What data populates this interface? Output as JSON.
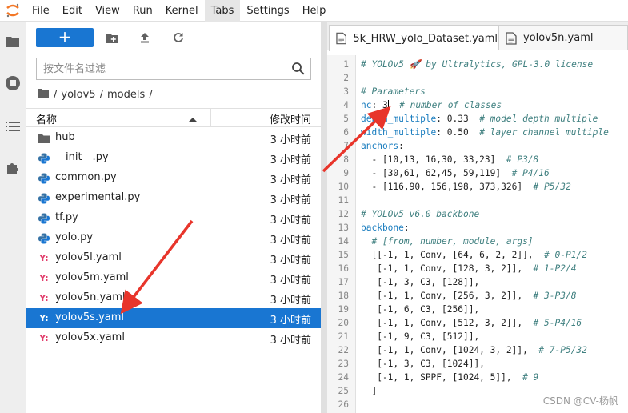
{
  "menubar": {
    "items": [
      "File",
      "Edit",
      "View",
      "Run",
      "Kernel",
      "Tabs",
      "Settings",
      "Help"
    ],
    "active": "Tabs"
  },
  "filebrowser": {
    "new_label": "+",
    "search": {
      "placeholder": "按文件名过滤"
    },
    "breadcrumb": [
      "/",
      "yolov5",
      "/",
      "models",
      "/"
    ],
    "header": {
      "name": "名称",
      "modified": "修改时间"
    },
    "rows": [
      {
        "name": "hub",
        "type": "folder",
        "modified": "3 小时前"
      },
      {
        "name": "__init__.py",
        "type": "python",
        "modified": "3 小时前"
      },
      {
        "name": "common.py",
        "type": "python",
        "modified": "3 小时前"
      },
      {
        "name": "experimental.py",
        "type": "python",
        "modified": "3 小时前"
      },
      {
        "name": "tf.py",
        "type": "python",
        "modified": "3 小时前"
      },
      {
        "name": "yolo.py",
        "type": "python",
        "modified": "3 小时前"
      },
      {
        "name": "yolov5l.yaml",
        "type": "yaml",
        "modified": "3 小时前"
      },
      {
        "name": "yolov5m.yaml",
        "type": "yaml",
        "modified": "3 小时前"
      },
      {
        "name": "yolov5n.yaml",
        "type": "yaml",
        "modified": "3 小时前"
      },
      {
        "name": "yolov5s.yaml",
        "type": "yaml",
        "modified": "3 小时前",
        "selected": true
      },
      {
        "name": "yolov5x.yaml",
        "type": "yaml",
        "modified": "3 小时前"
      }
    ]
  },
  "editor": {
    "tabs": [
      {
        "label": "5k_HRW_yolo_Dataset.yaml",
        "active": true
      },
      {
        "label": "yolov5n.yaml",
        "active": false
      }
    ],
    "lines": [
      {
        "n": "1",
        "segs": [
          {
            "t": "# YOLOv5 🚀 by Ultralytics, GPL-3.0 license",
            "c": "comment"
          }
        ]
      },
      {
        "n": "2",
        "segs": []
      },
      {
        "n": "3",
        "segs": [
          {
            "t": "# Parameters",
            "c": "comment"
          }
        ]
      },
      {
        "n": "4",
        "segs": [
          {
            "t": "nc",
            "c": "key"
          },
          {
            "t": ": 3",
            "c": "num"
          },
          {
            "t": "CURSOR",
            "c": "cursor"
          },
          {
            "t": "  # number of classes",
            "c": "comment"
          }
        ]
      },
      {
        "n": "5",
        "segs": [
          {
            "t": "depth_multiple",
            "c": "key"
          },
          {
            "t": ": 0.33  ",
            "c": "num"
          },
          {
            "t": "# model depth multiple",
            "c": "comment"
          }
        ]
      },
      {
        "n": "6",
        "segs": [
          {
            "t": "width_multiple",
            "c": "key"
          },
          {
            "t": ": 0.50  ",
            "c": "num"
          },
          {
            "t": "# layer channel multiple",
            "c": "comment"
          }
        ]
      },
      {
        "n": "7",
        "segs": [
          {
            "t": "anchors",
            "c": "key"
          },
          {
            "t": ":",
            "c": "num"
          }
        ]
      },
      {
        "n": "8",
        "segs": [
          {
            "t": "  - [10,13, 16,30, 33,23]  ",
            "c": "num"
          },
          {
            "t": "# P3/8",
            "c": "comment"
          }
        ]
      },
      {
        "n": "9",
        "segs": [
          {
            "t": "  - [30,61, 62,45, 59,119]  ",
            "c": "num"
          },
          {
            "t": "# P4/16",
            "c": "comment"
          }
        ]
      },
      {
        "n": "10",
        "segs": [
          {
            "t": "  - [116,90, 156,198, 373,326]  ",
            "c": "num"
          },
          {
            "t": "# P5/32",
            "c": "comment"
          }
        ]
      },
      {
        "n": "11",
        "segs": []
      },
      {
        "n": "12",
        "segs": [
          {
            "t": "# YOLOv5 v6.0 backbone",
            "c": "comment"
          }
        ]
      },
      {
        "n": "13",
        "segs": [
          {
            "t": "backbone",
            "c": "key"
          },
          {
            "t": ":",
            "c": "num"
          }
        ]
      },
      {
        "n": "14",
        "segs": [
          {
            "t": "  # [from, number, module, args]",
            "c": "comment"
          }
        ]
      },
      {
        "n": "15",
        "segs": [
          {
            "t": "  [[-1, 1, Conv, [64, 6, 2, 2]],  ",
            "c": "num"
          },
          {
            "t": "# 0-P1/2",
            "c": "comment"
          }
        ]
      },
      {
        "n": "16",
        "segs": [
          {
            "t": "   [-1, 1, Conv, [128, 3, 2]],  ",
            "c": "num"
          },
          {
            "t": "# 1-P2/4",
            "c": "comment"
          }
        ]
      },
      {
        "n": "17",
        "segs": [
          {
            "t": "   [-1, 3, C3, [128]],",
            "c": "num"
          }
        ]
      },
      {
        "n": "18",
        "segs": [
          {
            "t": "   [-1, 1, Conv, [256, 3, 2]],  ",
            "c": "num"
          },
          {
            "t": "# 3-P3/8",
            "c": "comment"
          }
        ]
      },
      {
        "n": "19",
        "segs": [
          {
            "t": "   [-1, 6, C3, [256]],",
            "c": "num"
          }
        ]
      },
      {
        "n": "20",
        "segs": [
          {
            "t": "   [-1, 1, Conv, [512, 3, 2]],  ",
            "c": "num"
          },
          {
            "t": "# 5-P4/16",
            "c": "comment"
          }
        ]
      },
      {
        "n": "21",
        "segs": [
          {
            "t": "   [-1, 9, C3, [512]],",
            "c": "num"
          }
        ]
      },
      {
        "n": "22",
        "segs": [
          {
            "t": "   [-1, 1, Conv, [1024, 3, 2]],  ",
            "c": "num"
          },
          {
            "t": "# 7-P5/32",
            "c": "comment"
          }
        ]
      },
      {
        "n": "23",
        "segs": [
          {
            "t": "   [-1, 3, C3, [1024]],",
            "c": "num"
          }
        ]
      },
      {
        "n": "24",
        "segs": [
          {
            "t": "   [-1, 1, SPPF, [1024, 5]],  ",
            "c": "num"
          },
          {
            "t": "# 9",
            "c": "comment"
          }
        ]
      },
      {
        "n": "25",
        "segs": [
          {
            "t": "  ]",
            "c": "num"
          }
        ]
      },
      {
        "n": "26",
        "segs": []
      }
    ]
  },
  "watermark": "CSDN @CV-杨帆",
  "colors": {
    "accent": "#1976d2",
    "annotation_arrow": "#e8352b",
    "yaml_icon": "#e23c6b"
  }
}
